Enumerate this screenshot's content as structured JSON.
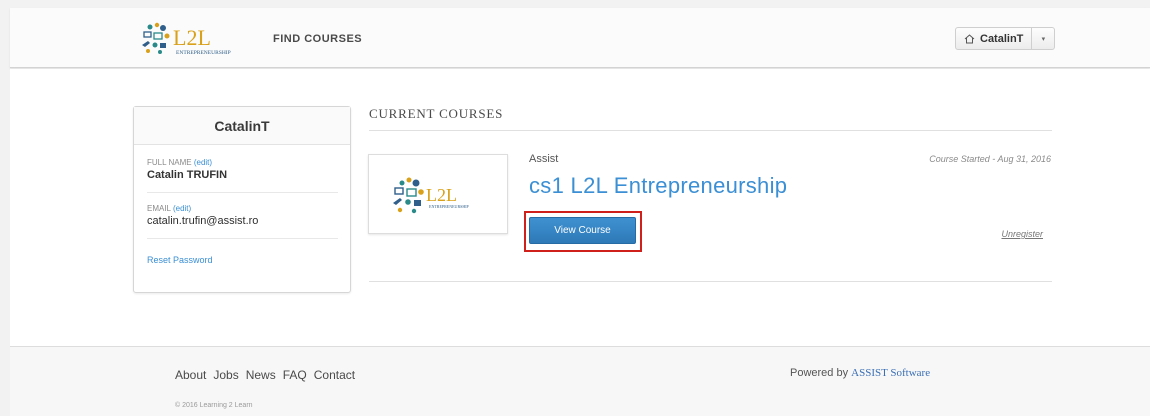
{
  "header": {
    "logo_text": "L2L",
    "logo_subtext": "ENTREPRENEURSHIP",
    "nav_find_courses": "FIND COURSES",
    "user_menu": {
      "username": "CatalinT",
      "icon": "home-icon",
      "caret": "▾"
    }
  },
  "profile": {
    "username": "CatalinT",
    "full_name_label": "FULL NAME",
    "full_name_edit": "(edit)",
    "full_name": "Catalin TRUFIN",
    "email_label": "EMAIL",
    "email_edit": "(edit)",
    "email": "catalin.trufin@assist.ro",
    "reset_password": "Reset Password"
  },
  "courses": {
    "section_title": "CURRENT COURSES",
    "items": [
      {
        "org": "Assist",
        "title": "cs1 L2L Entrepreneurship",
        "started": "Course Started - Aug 31, 2016",
        "view_button": "View Course",
        "unregister": "Unregister",
        "image_logo_text": "L2L",
        "image_logo_subtext": "ENTREPRENEURSHIP"
      }
    ]
  },
  "footer": {
    "links": [
      "About",
      "Jobs",
      "News",
      "FAQ",
      "Contact"
    ],
    "copyright": "© 2016 Learning 2 Learn",
    "powered_by": "Powered by",
    "powered_brand": "ASSIST Software"
  },
  "colors": {
    "link_blue": "#3b8fd4",
    "button_blue": "#3a86c6",
    "highlight_red": "#d0201b",
    "logo_gold": "#d9a11a",
    "logo_blue": "#2f5f8a",
    "logo_teal": "#2a8a8a"
  }
}
